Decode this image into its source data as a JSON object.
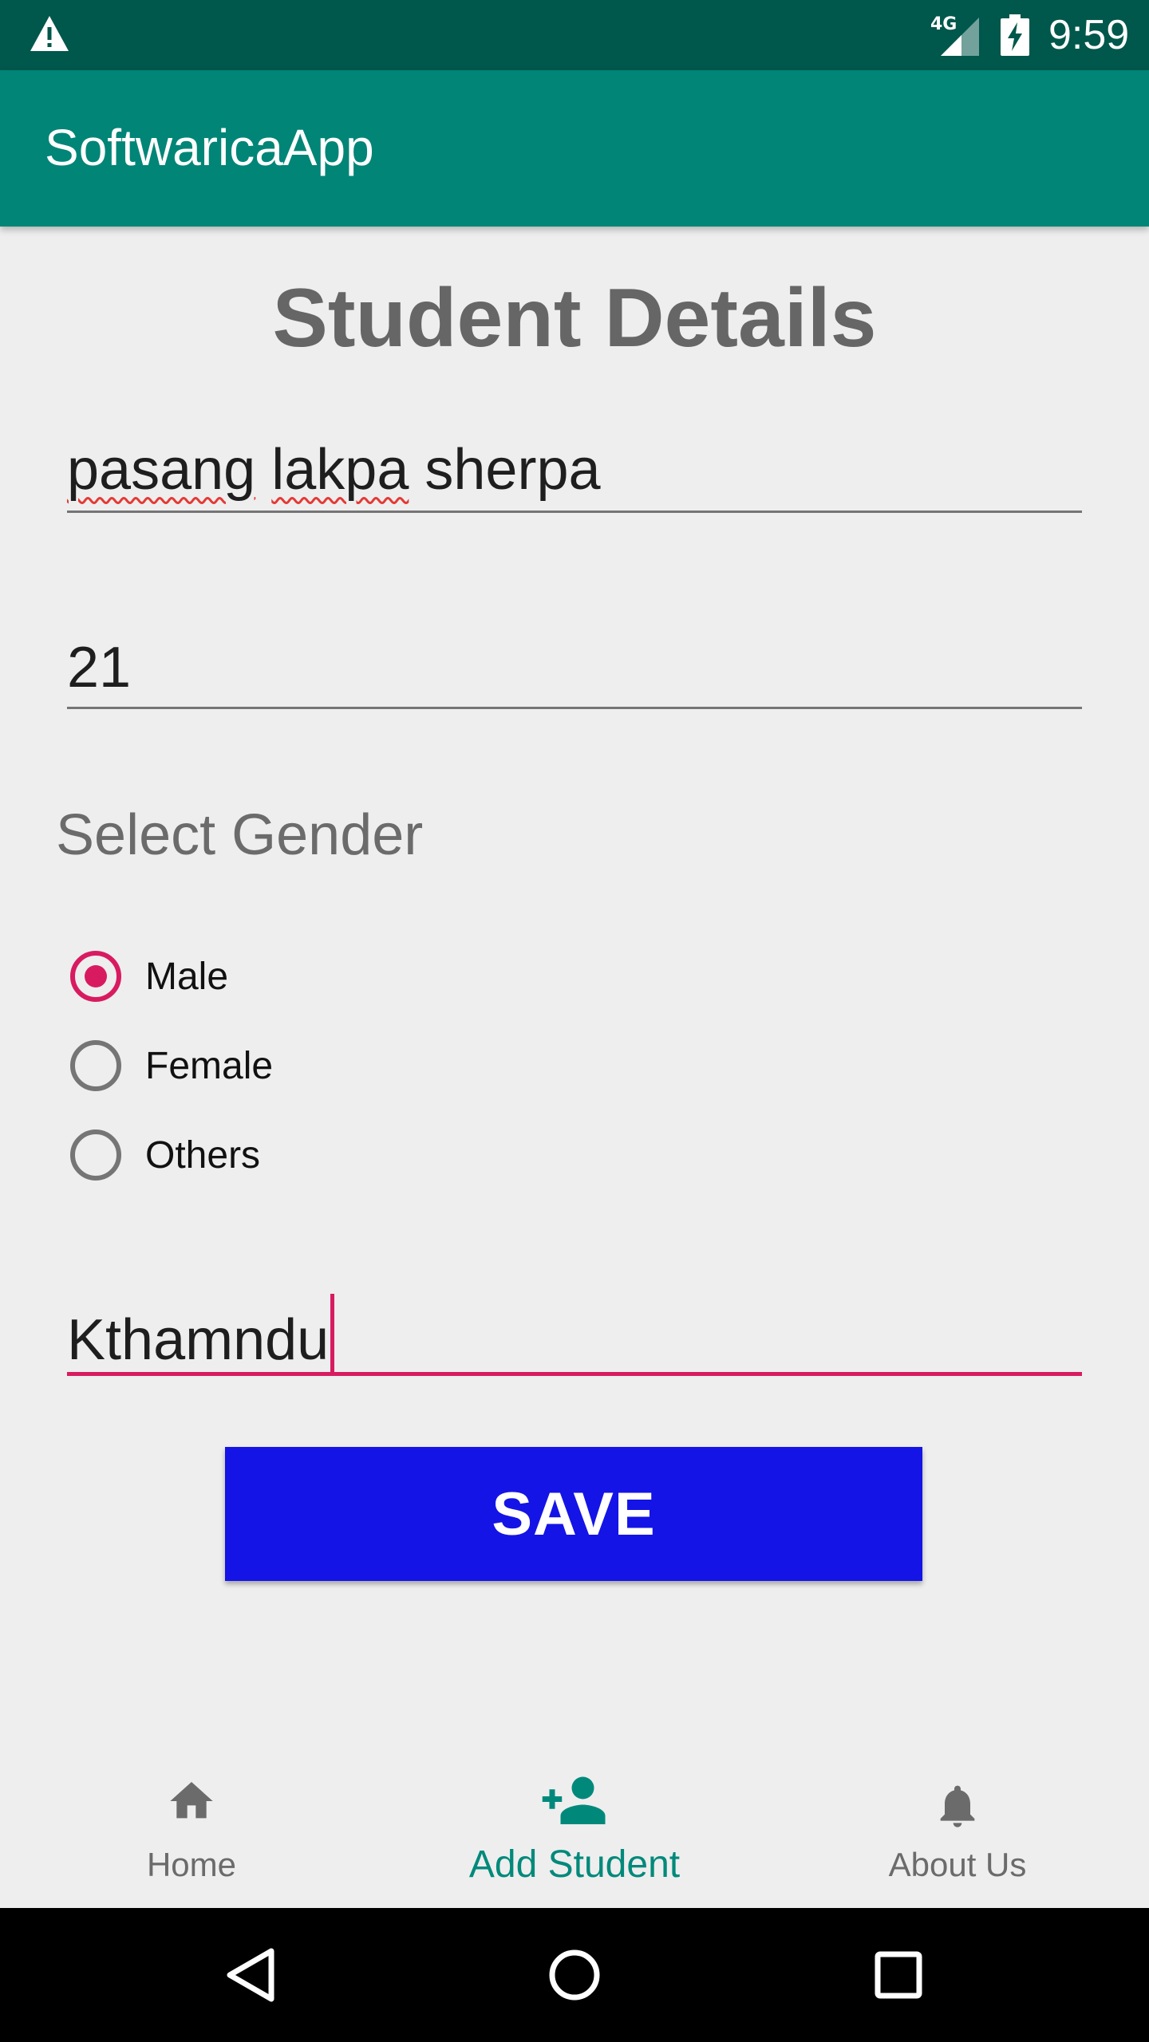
{
  "status_bar": {
    "network": "4G",
    "time": "9:59"
  },
  "app_bar": {
    "title": "SoftwaricaApp"
  },
  "form": {
    "heading": "Student Details",
    "name_part1": "pasang",
    "name_part2": "lakpa",
    "name_part3": "sherpa",
    "age_value": "21",
    "gender_label": "Select Gender",
    "gender_options": [
      "Male",
      "Female",
      "Others"
    ],
    "gender_selected": "Male",
    "address_value": "Kthamndu",
    "save_label": "SAVE"
  },
  "colors": {
    "primary": "#008577",
    "primary_dark": "#00574b",
    "accent": "#d81b60",
    "save_button": "#1414e6",
    "nav_active": "#00897b"
  },
  "bottom_nav": {
    "items": [
      {
        "label": "Home",
        "icon": "home-icon"
      },
      {
        "label": "Add Student",
        "icon": "person-add-icon",
        "active": true
      },
      {
        "label": "About Us",
        "icon": "bell-icon"
      }
    ]
  },
  "system_nav": {
    "buttons": [
      "back-icon",
      "home-circle-icon",
      "recents-icon"
    ]
  }
}
